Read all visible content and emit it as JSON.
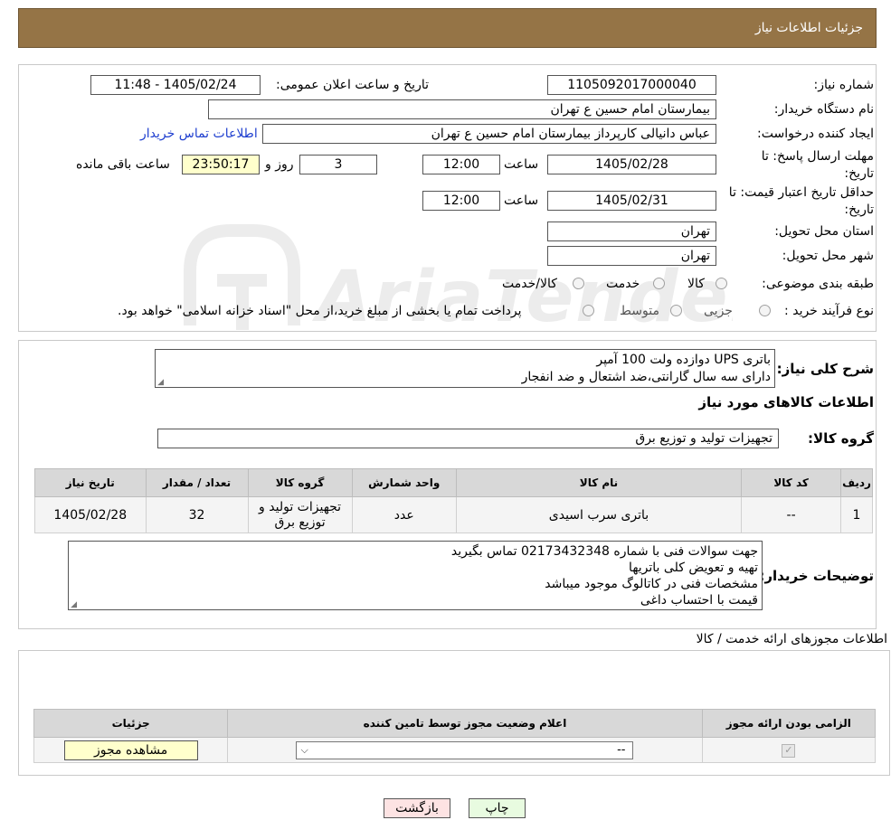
{
  "header": {
    "title": "جزئیات اطلاعات نیاز"
  },
  "form": {
    "need_number_label": "شماره نیاز:",
    "need_number": "1105092017000040",
    "announce_label": "تاریخ و ساعت اعلان عمومی:",
    "announce_value": "1405/02/24 - 11:48",
    "buyer_org_label": "نام دستگاه خریدار:",
    "buyer_org": "بیمارستان امام حسین  ع  تهران",
    "creator_label": "ایجاد کننده درخواست:",
    "creator": "عباس دانیالی کارپرداز بیمارستان امام حسین  ع  تهران",
    "contact_link": "اطلاعات تماس خریدار",
    "deadline_label_1": "مهلت ارسال پاسخ: تا",
    "deadline_label_2": "تاریخ:",
    "deadline_date": "1405/02/28",
    "time_label": "ساعت",
    "deadline_time": "12:00",
    "days_value": "3",
    "days_label": "روز و",
    "remaining_time": "23:50:17",
    "remaining_label": "ساعت باقی مانده",
    "validity_label_1": "حداقل تاریخ اعتبار قیمت: تا",
    "validity_label_2": "تاریخ:",
    "validity_date": "1405/02/31",
    "validity_time": "12:00",
    "province_label": "استان محل تحویل:",
    "province": "تهران",
    "city_label": "شهر محل تحویل:",
    "city": "تهران",
    "category_label": "طبقه بندی موضوعی:",
    "category_options": [
      "کالا",
      "خدمت",
      "کالا/خدمت"
    ],
    "process_label": "نوع فرآیند خرید :",
    "process_options": [
      "جزیی",
      "متوسط"
    ],
    "process_note": "پرداخت تمام یا بخشی از مبلغ خرید،از محل \"اسناد خزانه اسلامی\" خواهد بود."
  },
  "summary": {
    "label": "شرح کلی نیاز:",
    "lines": [
      "باتری UPS دوازده ولت 100 آمپر",
      "دارای سه سال گارانتی،ضد اشتعال و ضد انفجار"
    ]
  },
  "goods": {
    "section_title": "اطلاعات کالاهای مورد نیاز",
    "group_label": "گروه کالا:",
    "group_value": "تجهیزات تولید و توزیع برق",
    "columns": [
      "ردیف",
      "کد کالا",
      "نام کالا",
      "واحد شمارش",
      "گروه کالا",
      "تعداد / مقدار",
      "تاریخ نیاز"
    ],
    "rows": [
      {
        "row": "1",
        "code": "--",
        "name": "باتری سرب اسیدی",
        "unit": "عدد",
        "group": "تجهیزات تولید و توزیع برق",
        "qty": "32",
        "date": "1405/02/28"
      }
    ]
  },
  "buyer_notes": {
    "label": "توضیحات خریدار:",
    "lines": [
      "جهت سوالات فنی با شماره 02173432348 تماس بگیرید",
      "تهیه و تعویض کلی باتریها",
      "مشخصات فنی در کاتالوگ موجود میباشد",
      "قیمت با احتساب داغی"
    ]
  },
  "permits": {
    "section_title": "اطلاعات مجوزهای ارائه خدمت / کالا",
    "columns": [
      "الزامی بودن ارائه مجوز",
      "اعلام وضعیت مجوز توسط تامین کننده",
      "جزئیات"
    ],
    "select_value": "--",
    "view_button": "مشاهده مجوز"
  },
  "footer": {
    "print_button": "چاپ",
    "back_button": "بازگشت"
  },
  "watermark": "AriaTender.neT"
}
